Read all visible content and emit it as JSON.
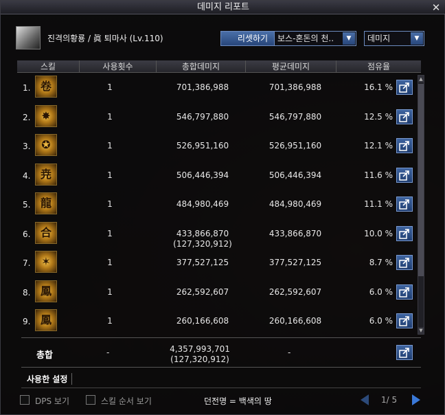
{
  "window": {
    "title": "데미지 리포트"
  },
  "header": {
    "character": "진격의황룡 / 眞 퇴마사 (Lv.110)",
    "reset_label": "리셋하기",
    "dungeon_select": "보스-혼돈의 천..",
    "type_select": "데미지"
  },
  "columns": [
    "스킬",
    "사용횟수",
    "총합데미지",
    "평균데미지",
    "점유율"
  ],
  "rows": [
    {
      "rank": "1.",
      "icon": "scroll-talisman-icon",
      "uses": "1",
      "total": "701,386,988",
      "total2": "",
      "avg": "701,386,988",
      "share": "16.1 %"
    },
    {
      "rank": "2.",
      "icon": "lightning-burst-icon",
      "uses": "1",
      "total": "546,797,880",
      "total2": "",
      "avg": "546,797,880",
      "share": "12.5 %"
    },
    {
      "rank": "3.",
      "icon": "pentagram-icon",
      "uses": "1",
      "total": "526,951,160",
      "total2": "",
      "avg": "526,951,160",
      "share": "12.1 %"
    },
    {
      "rank": "4.",
      "icon": "glyph-seal-icon",
      "uses": "1",
      "total": "506,446,394",
      "total2": "",
      "avg": "506,446,394",
      "share": "11.6 %"
    },
    {
      "rank": "5.",
      "icon": "dragon-icon",
      "uses": "1",
      "total": "484,980,469",
      "total2": "",
      "avg": "484,980,469",
      "share": "11.1 %"
    },
    {
      "rank": "6.",
      "icon": "union-seal-icon",
      "uses": "1",
      "total": "433,866,870",
      "total2": "(127,320,912)",
      "avg": "433,866,870",
      "share": "10.0 %"
    },
    {
      "rank": "7.",
      "icon": "radiant-strike-icon",
      "uses": "1",
      "total": "377,527,125",
      "total2": "",
      "avg": "377,527,125",
      "share": "8.7 %"
    },
    {
      "rank": "8.",
      "icon": "phoenix-icon",
      "uses": "1",
      "total": "262,592,607",
      "total2": "",
      "avg": "262,592,607",
      "share": "6.0 %"
    },
    {
      "rank": "9.",
      "icon": "seal-character-icon",
      "uses": "1",
      "total": "260,166,608",
      "total2": "",
      "avg": "260,166,608",
      "share": "6.0 %"
    }
  ],
  "total": {
    "label": "총합",
    "uses": "-",
    "damage": "4,357,993,701",
    "damage2": "(127,320,912)",
    "avg": "-"
  },
  "settings": {
    "label": "사용한 설정"
  },
  "footer": {
    "dps_label": "DPS 보기",
    "skill_order_label": "스킬 순서 보기",
    "dungeon": "던전명 = 백색의 땅",
    "page": "1/ 5"
  }
}
